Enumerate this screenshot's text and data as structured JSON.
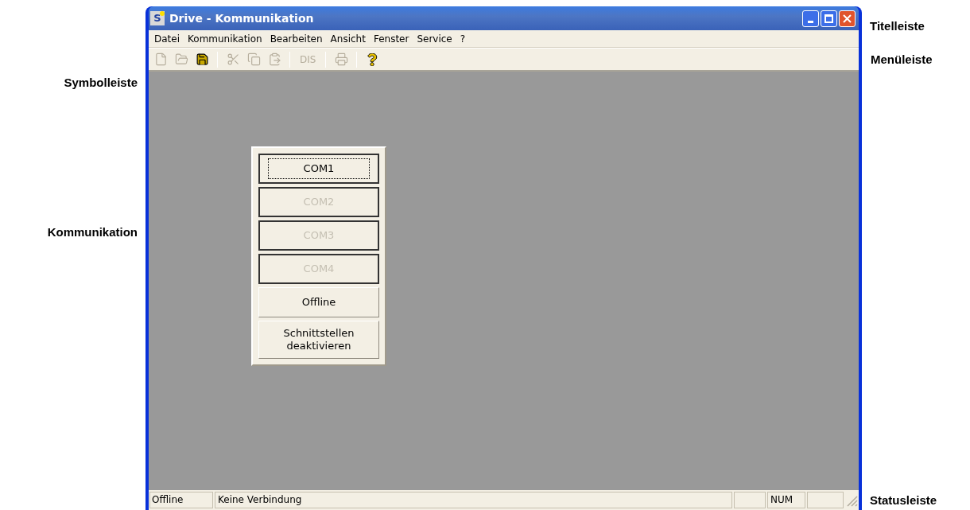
{
  "annotations": {
    "title_bar": "Titelleiste",
    "menu_bar": "Menüleiste",
    "toolbar": "Symbolleiste",
    "communication": "Kommunikation",
    "status_bar": "Statusleiste"
  },
  "window": {
    "logo_text": "S",
    "title": "Drive - Kommunikation"
  },
  "menu": [
    "Datei",
    "Kommunikation",
    "Bearbeiten",
    "Ansicht",
    "Fenster",
    "Service",
    "?"
  ],
  "toolbar": [
    {
      "kind": "new",
      "disabled": true
    },
    {
      "kind": "open",
      "disabled": true
    },
    {
      "kind": "save",
      "disabled": false
    },
    {
      "kind": "separator"
    },
    {
      "kind": "cut",
      "disabled": true
    },
    {
      "kind": "copy",
      "disabled": true
    },
    {
      "kind": "paste",
      "disabled": true
    },
    {
      "kind": "separator"
    },
    {
      "kind": "text",
      "label": "DIS",
      "disabled": true
    },
    {
      "kind": "separator"
    },
    {
      "kind": "print",
      "disabled": true
    },
    {
      "kind": "separator"
    },
    {
      "kind": "help",
      "disabled": false
    }
  ],
  "ports": [
    {
      "label": "COM1",
      "disabled": false,
      "focused": true,
      "framed": true
    },
    {
      "label": "COM2",
      "disabled": true,
      "focused": false,
      "framed": true
    },
    {
      "label": "COM3",
      "disabled": true,
      "focused": false,
      "framed": true
    },
    {
      "label": "COM4",
      "disabled": true,
      "focused": false,
      "framed": true
    },
    {
      "label": "Offline",
      "disabled": false,
      "focused": false,
      "framed": false
    },
    {
      "label": "Schnittstellen deaktivieren",
      "disabled": false,
      "focused": false,
      "framed": false
    }
  ],
  "status_bar": {
    "state": "Offline",
    "message": "Keine Verbindung",
    "num": "NUM"
  }
}
